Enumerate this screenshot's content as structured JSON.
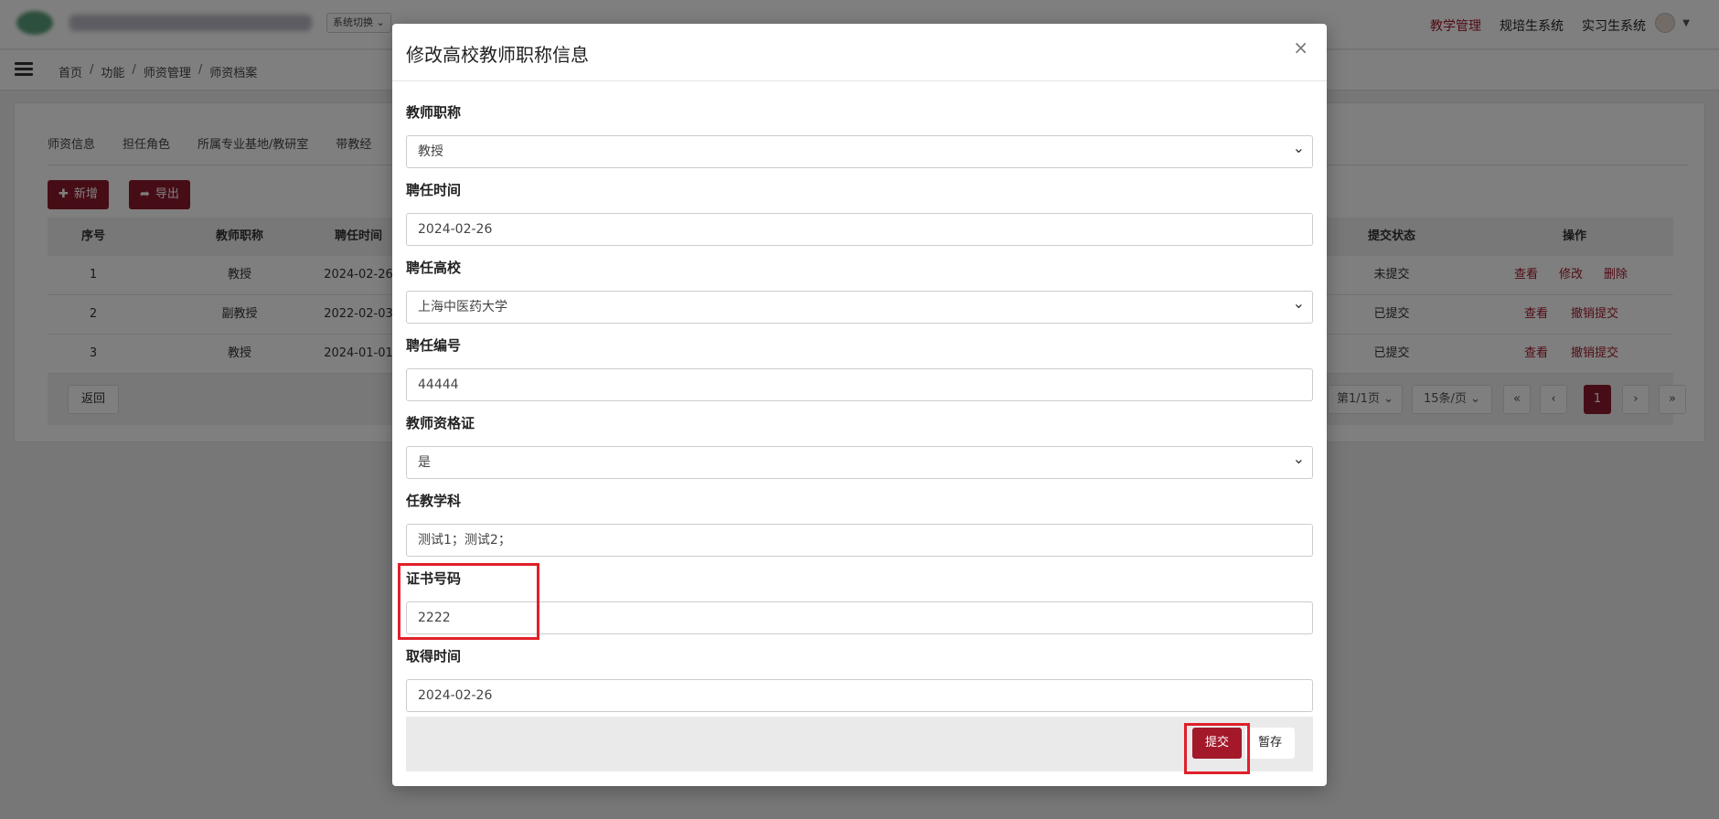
{
  "topbar": {
    "system_switch": "系统切换",
    "nav": [
      {
        "label": "教学管理",
        "active": true
      },
      {
        "label": "规培生系统",
        "active": false
      },
      {
        "label": "实习生系统",
        "active": false
      }
    ]
  },
  "breadcrumb": [
    "首页",
    "功能",
    "师资管理",
    "师资档案"
  ],
  "tabs": [
    "师资信息",
    "担任角色",
    "所属专业基地/教研室",
    "带教经"
  ],
  "toolbar": {
    "add_label": "新增",
    "export_label": "导出"
  },
  "table": {
    "headers": {
      "index": "序号",
      "title": "教师职称",
      "date": "聘任时间",
      "status": "提交状态",
      "actions": "操作"
    },
    "rows": [
      {
        "index": "1",
        "title": "教授",
        "date": "2024-02-26",
        "status": "未提交",
        "actions": [
          "查看",
          "修改",
          "删除"
        ]
      },
      {
        "index": "2",
        "title": "副教授",
        "date": "2022-02-03",
        "status": "已提交",
        "actions": [
          "查看",
          "撤销提交"
        ]
      },
      {
        "index": "3",
        "title": "教授",
        "date": "2024-01-01",
        "status": "已提交",
        "actions": [
          "查看",
          "撤销提交"
        ]
      }
    ]
  },
  "footer": {
    "back_label": "返回",
    "page_info": "第1/1页",
    "page_size": "15条/页",
    "first": "«",
    "prev": "‹",
    "current_page": "1",
    "next": "›",
    "last": "»"
  },
  "modal": {
    "title": "修改高校教师职称信息",
    "close": "×",
    "fields": [
      {
        "label": "教师职称",
        "value": "教授",
        "type": "select"
      },
      {
        "label": "聘任时间",
        "value": "2024-02-26",
        "type": "input"
      },
      {
        "label": "聘任高校",
        "value": "上海中医药大学",
        "type": "select"
      },
      {
        "label": "聘任编号",
        "value": "44444",
        "type": "input"
      },
      {
        "label": "教师资格证",
        "value": "是",
        "type": "select"
      },
      {
        "label": "任教学科",
        "value": "测试1；测试2；",
        "type": "input"
      },
      {
        "label": "证书号码",
        "value": "2222",
        "type": "input"
      },
      {
        "label": "取得时间",
        "value": "2024-02-26",
        "type": "input"
      }
    ],
    "submit_label": "提交",
    "save_label": "暂存"
  },
  "colors": {
    "brand": "#8e1b2d",
    "accent": "#a3192a",
    "highlight": "#e0202a"
  }
}
